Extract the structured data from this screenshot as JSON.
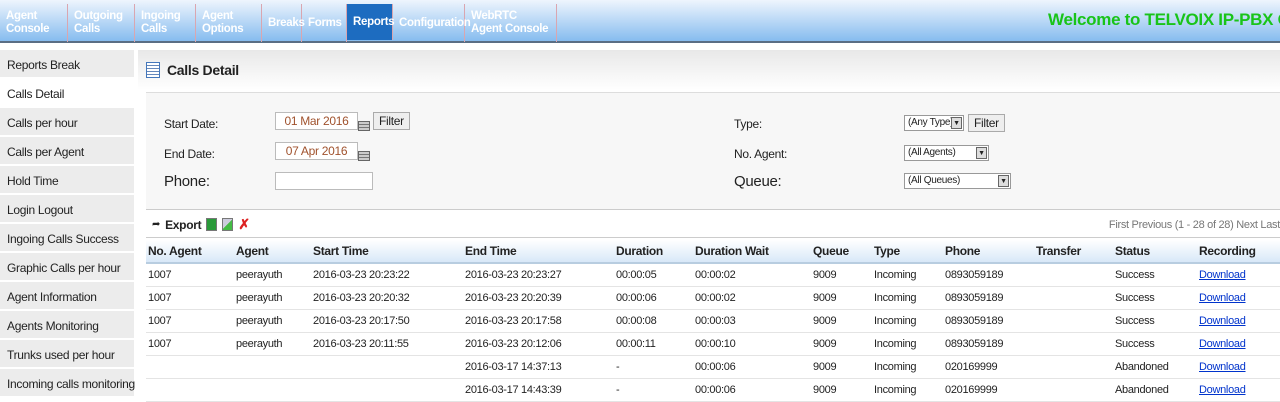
{
  "nav": {
    "items": [
      "Agent Console",
      "Outgoing Calls",
      "Ingoing Calls",
      "Agent Options",
      "Breaks",
      "Forms",
      "Reports",
      "Configuration",
      "WebRTC Agent Console"
    ],
    "active": "Reports",
    "welcome": "Welcome to TELVOIX IP-PBX CallCenter"
  },
  "sidebar": {
    "items": [
      "Reports Break",
      "Calls Detail",
      "Calls per hour",
      "Calls per Agent",
      "Hold Time",
      "Login Logout",
      "Ingoing Calls Success",
      "Graphic Calls per hour",
      "Agent Information",
      "Agents Monitoring",
      "Trunks used per hour",
      "Incoming calls monitoring"
    ],
    "active": "Calls Detail"
  },
  "page": {
    "title": "Calls Detail",
    "icon": "list-icon"
  },
  "filters": {
    "start_label": "Start Date:",
    "start_value": "01 Mar 2016",
    "end_label": "End Date:",
    "end_value": "07 Apr 2016",
    "phone_label": "Phone:",
    "phone_value": "",
    "filter": "Filter",
    "type_label": "Type:",
    "type_value": "(Any Type)",
    "agent_label": "No. Agent:",
    "agent_value": "(All Agents)",
    "queue_label": "Queue:",
    "queue_value": "(All Queues)"
  },
  "toolbar": {
    "export": "Export",
    "pager": "First  Previous (1 - 28 of 28) Next  Last"
  },
  "table": {
    "headers": [
      "No. Agent",
      "Agent",
      "Start Time",
      "End Time",
      "Duration",
      "Duration Wait",
      "Queue",
      "Type",
      "Phone",
      "Transfer",
      "Status",
      "Recording"
    ],
    "rows": [
      [
        "1007",
        "peerayuth",
        "2016-03-23 20:23:22",
        "2016-03-23 20:23:27",
        "00:00:05",
        "00:00:02",
        "9009",
        "Incoming",
        "0893059189",
        "",
        "Success",
        "Download"
      ],
      [
        "1007",
        "peerayuth",
        "2016-03-23 20:20:32",
        "2016-03-23 20:20:39",
        "00:00:06",
        "00:00:02",
        "9009",
        "Incoming",
        "0893059189",
        "",
        "Success",
        "Download"
      ],
      [
        "1007",
        "peerayuth",
        "2016-03-23 20:17:50",
        "2016-03-23 20:17:58",
        "00:00:08",
        "00:00:03",
        "9009",
        "Incoming",
        "0893059189",
        "",
        "Success",
        "Download"
      ],
      [
        "1007",
        "peerayuth",
        "2016-03-23 20:11:55",
        "2016-03-23 20:12:06",
        "00:00:11",
        "00:00:10",
        "9009",
        "Incoming",
        "0893059189",
        "",
        "Success",
        "Download"
      ],
      [
        "",
        "",
        "",
        "2016-03-17 14:37:13",
        "-",
        "00:00:06",
        "9009",
        "Incoming",
        "020169999",
        "",
        "Abandoned",
        "Download"
      ],
      [
        "",
        "",
        "",
        "2016-03-17 14:43:39",
        "-",
        "00:00:06",
        "9009",
        "Incoming",
        "020169999",
        "",
        "Abandoned",
        "Download"
      ]
    ]
  },
  "colors": {
    "nav_active": "#1d6cc0",
    "welcome": "#19c419",
    "link": "#0033cc"
  }
}
